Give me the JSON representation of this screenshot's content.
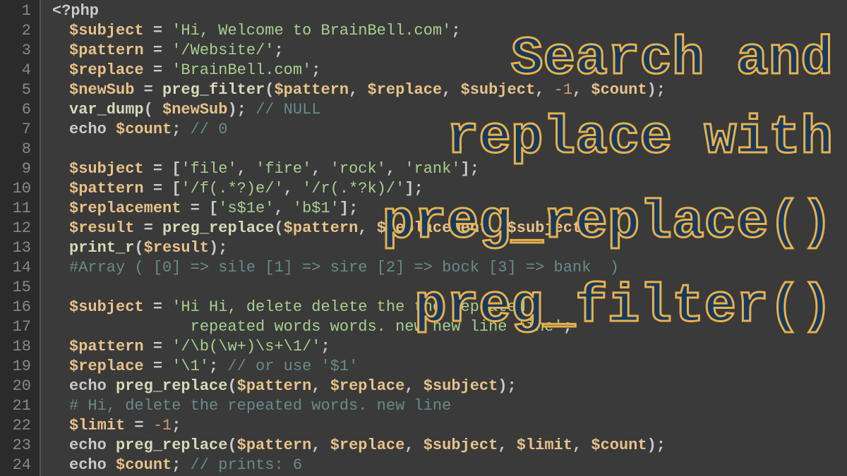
{
  "lines": [
    {
      "n": "1",
      "tokens": [
        [
          "punc",
          "<?"
        ],
        [
          "kw",
          "php"
        ]
      ]
    },
    {
      "n": "2",
      "tokens": [
        [
          "indent",
          ""
        ],
        [
          "var",
          "$subject"
        ],
        [
          "op",
          " = "
        ],
        [
          "str",
          "'Hi, Welcome to BrainBell.com'"
        ],
        [
          "punc",
          ";"
        ]
      ]
    },
    {
      "n": "3",
      "tokens": [
        [
          "indent",
          ""
        ],
        [
          "var",
          "$pattern"
        ],
        [
          "op",
          " = "
        ],
        [
          "str",
          "'/Website/'"
        ],
        [
          "punc",
          ";"
        ]
      ]
    },
    {
      "n": "4",
      "tokens": [
        [
          "indent",
          ""
        ],
        [
          "var",
          "$replace"
        ],
        [
          "op",
          " = "
        ],
        [
          "str",
          "'BrainBell.com'"
        ],
        [
          "punc",
          ";"
        ]
      ]
    },
    {
      "n": "5",
      "tokens": [
        [
          "indent",
          ""
        ],
        [
          "var",
          "$newSub"
        ],
        [
          "op",
          " = "
        ],
        [
          "fn",
          "preg_filter"
        ],
        [
          "br",
          "("
        ],
        [
          "var",
          "$pattern"
        ],
        [
          "punc",
          ", "
        ],
        [
          "var",
          "$replace"
        ],
        [
          "punc",
          ", "
        ],
        [
          "var",
          "$subject"
        ],
        [
          "punc",
          ", "
        ],
        [
          "num",
          "-1"
        ],
        [
          "punc",
          ", "
        ],
        [
          "var",
          "$count"
        ],
        [
          "br",
          ")"
        ],
        [
          "punc",
          ";"
        ]
      ]
    },
    {
      "n": "6",
      "tokens": [
        [
          "indent",
          ""
        ],
        [
          "fn",
          "var_dump"
        ],
        [
          "br",
          "( "
        ],
        [
          "var",
          "$newSub"
        ],
        [
          "br",
          ")"
        ],
        [
          "punc",
          "; "
        ],
        [
          "cm",
          "// NULL"
        ]
      ]
    },
    {
      "n": "7",
      "tokens": [
        [
          "indent",
          ""
        ],
        [
          "kw",
          "echo "
        ],
        [
          "var",
          "$count"
        ],
        [
          "punc",
          "; "
        ],
        [
          "cm",
          "// 0"
        ]
      ]
    },
    {
      "n": "8",
      "tokens": []
    },
    {
      "n": "9",
      "tokens": [
        [
          "indent",
          ""
        ],
        [
          "var",
          "$subject"
        ],
        [
          "op",
          " = "
        ],
        [
          "br",
          "["
        ],
        [
          "str",
          "'file'"
        ],
        [
          "punc",
          ", "
        ],
        [
          "str",
          "'fire'"
        ],
        [
          "punc",
          ", "
        ],
        [
          "str",
          "'rock'"
        ],
        [
          "punc",
          ", "
        ],
        [
          "str",
          "'rank'"
        ],
        [
          "br",
          "]"
        ],
        [
          "punc",
          ";"
        ]
      ]
    },
    {
      "n": "10",
      "tokens": [
        [
          "indent",
          ""
        ],
        [
          "var",
          "$pattern"
        ],
        [
          "op",
          " = "
        ],
        [
          "br",
          "["
        ],
        [
          "str",
          "'/f(.*?)e/'"
        ],
        [
          "punc",
          ", "
        ],
        [
          "str",
          "'/r(.*?k)/'"
        ],
        [
          "br",
          "]"
        ],
        [
          "punc",
          ";"
        ]
      ]
    },
    {
      "n": "11",
      "tokens": [
        [
          "indent",
          ""
        ],
        [
          "var",
          "$replacement"
        ],
        [
          "op",
          " = "
        ],
        [
          "br",
          "["
        ],
        [
          "str",
          "'s$1e'"
        ],
        [
          "punc",
          ", "
        ],
        [
          "str",
          "'b$1'"
        ],
        [
          "br",
          "]"
        ],
        [
          "punc",
          ";"
        ]
      ]
    },
    {
      "n": "12",
      "tokens": [
        [
          "indent",
          ""
        ],
        [
          "var",
          "$result"
        ],
        [
          "op",
          " = "
        ],
        [
          "fn",
          "preg_replace"
        ],
        [
          "br",
          "("
        ],
        [
          "var",
          "$pattern"
        ],
        [
          "punc",
          ", "
        ],
        [
          "var",
          "$replacement"
        ],
        [
          "punc",
          ", "
        ],
        [
          "var",
          "$subject"
        ],
        [
          "br",
          ")"
        ],
        [
          "punc",
          ";"
        ]
      ]
    },
    {
      "n": "13",
      "tokens": [
        [
          "indent",
          ""
        ],
        [
          "fn",
          "print_r"
        ],
        [
          "br",
          "("
        ],
        [
          "var",
          "$result"
        ],
        [
          "br",
          ")"
        ],
        [
          "punc",
          ";"
        ]
      ]
    },
    {
      "n": "14",
      "tokens": [
        [
          "indent",
          ""
        ],
        [
          "cm",
          "#Array ( [0] => sile [1] => sire [2] => bock [3] => bank  )"
        ]
      ]
    },
    {
      "n": "15",
      "tokens": []
    },
    {
      "n": "16",
      "tokens": [
        [
          "indent",
          ""
        ],
        [
          "var",
          "$subject"
        ],
        [
          "op",
          " = "
        ],
        [
          "str",
          "'Hi Hi, delete delete the the repeated"
        ]
      ]
    },
    {
      "n": "17",
      "tokens": [
        [
          "indent",
          ""
        ],
        [
          "str",
          "             repeated words words. new new line line'"
        ],
        [
          "punc",
          ";"
        ]
      ]
    },
    {
      "n": "18",
      "tokens": [
        [
          "indent",
          ""
        ],
        [
          "var",
          "$pattern"
        ],
        [
          "op",
          " = "
        ],
        [
          "str",
          "'/\\\\b(\\\\w+)\\\\s+\\\\1/'"
        ],
        [
          "punc",
          ";"
        ]
      ]
    },
    {
      "n": "19",
      "tokens": [
        [
          "indent",
          ""
        ],
        [
          "var",
          "$replace"
        ],
        [
          "op",
          " = "
        ],
        [
          "str",
          "'\\\\1'"
        ],
        [
          "punc",
          "; "
        ],
        [
          "cm",
          "// or use '$1'"
        ]
      ]
    },
    {
      "n": "20",
      "tokens": [
        [
          "indent",
          ""
        ],
        [
          "kw",
          "echo "
        ],
        [
          "fn",
          "preg_replace"
        ],
        [
          "br",
          "("
        ],
        [
          "var",
          "$pattern"
        ],
        [
          "punc",
          ", "
        ],
        [
          "var",
          "$replace"
        ],
        [
          "punc",
          ", "
        ],
        [
          "var",
          "$subject"
        ],
        [
          "br",
          ")"
        ],
        [
          "punc",
          ";"
        ]
      ]
    },
    {
      "n": "21",
      "tokens": [
        [
          "indent",
          ""
        ],
        [
          "cm",
          "# Hi, delete the repeated words. new line"
        ]
      ]
    },
    {
      "n": "22",
      "tokens": [
        [
          "indent",
          ""
        ],
        [
          "var",
          "$limit"
        ],
        [
          "op",
          " = "
        ],
        [
          "num",
          "-1"
        ],
        [
          "punc",
          ";"
        ]
      ]
    },
    {
      "n": "23",
      "tokens": [
        [
          "indent",
          ""
        ],
        [
          "kw",
          "echo "
        ],
        [
          "fn",
          "preg_replace"
        ],
        [
          "br",
          "("
        ],
        [
          "var",
          "$pattern"
        ],
        [
          "punc",
          ", "
        ],
        [
          "var",
          "$replace"
        ],
        [
          "punc",
          ", "
        ],
        [
          "var",
          "$subject"
        ],
        [
          "punc",
          ", "
        ],
        [
          "var",
          "$limit"
        ],
        [
          "punc",
          ", "
        ],
        [
          "var",
          "$count"
        ],
        [
          "br",
          ")"
        ],
        [
          "punc",
          ";"
        ]
      ]
    },
    {
      "n": "24",
      "tokens": [
        [
          "indent",
          ""
        ],
        [
          "kw",
          "echo "
        ],
        [
          "var",
          "$count"
        ],
        [
          "punc",
          "; "
        ],
        [
          "cm",
          "// prints: 6"
        ]
      ]
    }
  ],
  "overlay": {
    "l1": "Search and",
    "l2": "replace with",
    "l3": "preg_replace()",
    "l4": "preg_filter()"
  }
}
